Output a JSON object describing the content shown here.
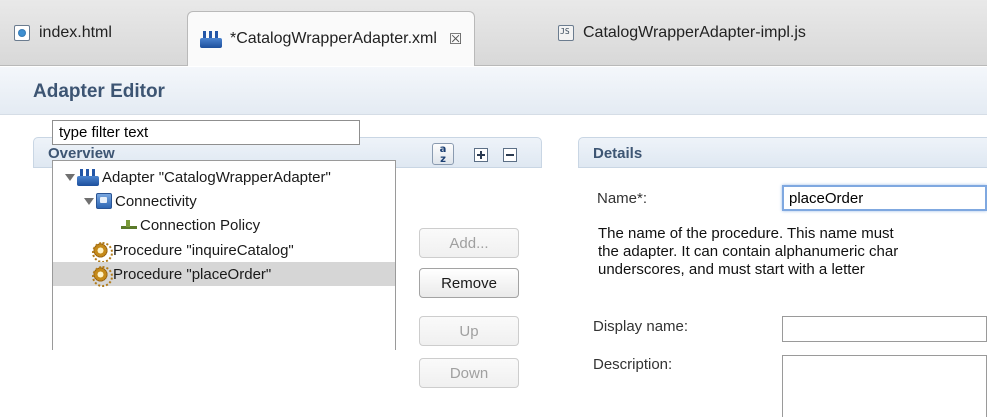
{
  "tabs": [
    {
      "label": "index.html",
      "icon": "html-file-icon"
    },
    {
      "label": "*CatalogWrapperAdapter.xml",
      "icon": "adapter-icon",
      "close": "☒"
    },
    {
      "label": "CatalogWrapperAdapter-impl.js",
      "icon": "js-file-icon"
    }
  ],
  "editor": {
    "title": "Adapter Editor"
  },
  "overview": {
    "title": "Overview",
    "filter_value": "type filter text",
    "tree": [
      {
        "label": "Adapter \"CatalogWrapperAdapter\"",
        "icon": "adapter-icon"
      },
      {
        "label": "Connectivity",
        "icon": "connectivity-icon"
      },
      {
        "label": "Connection Policy",
        "icon": "connection-policy-icon"
      },
      {
        "label": "Procedure \"inquireCatalog\"",
        "icon": "gear-icon"
      },
      {
        "label": "Procedure \"placeOrder\"",
        "icon": "gear-icon",
        "selected": true
      }
    ],
    "buttons": {
      "add": "Add...",
      "remove": "Remove",
      "up": "Up",
      "down": "Down"
    }
  },
  "details": {
    "title": "Details",
    "name_label": "Name*:",
    "name_value": "placeOrder",
    "description_lines": [
      "The name of the procedure. This name must",
      "the adapter. It can contain alphanumeric char",
      "underscores, and must start with a letter"
    ],
    "display_name_label": "Display name:",
    "display_name_value": "",
    "description_label": "Description:",
    "description_value": ""
  }
}
